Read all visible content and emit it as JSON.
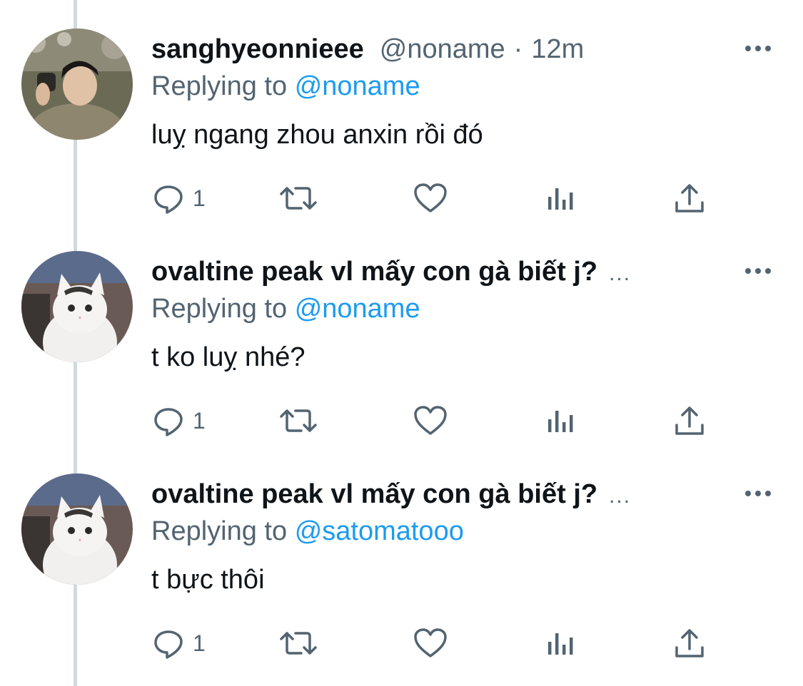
{
  "tweets": [
    {
      "name": "sanghyeonnieee",
      "handle": "@noname",
      "separator": "·",
      "time": "12m",
      "replying_prefix": "Replying to",
      "replying_to": "@noname",
      "text": "luỵ ngang zhou anxin rồi đó",
      "reply_count": "1",
      "avatar": "person-photo"
    },
    {
      "name": "ovaltine peak vl mấy con gà biết j?",
      "name_overflow": "...",
      "replying_prefix": "Replying to",
      "replying_to": "@noname",
      "text": "t ko luỵ nhé?",
      "reply_count": "1",
      "avatar": "cat-photo"
    },
    {
      "name": "ovaltine peak vl mấy con gà biết j?",
      "name_overflow": "...",
      "replying_prefix": "Replying to",
      "replying_to": "@satomatooo",
      "text": "t bực thôi",
      "reply_count": "1",
      "avatar": "cat-photo"
    }
  ],
  "colors": {
    "text": "#0f1419",
    "secondary": "#536471",
    "link": "#1d9bf0",
    "thread_line": "#cfd9de"
  },
  "icons": [
    "reply-icon",
    "retweet-icon",
    "like-icon",
    "analytics-icon",
    "share-icon",
    "more-icon"
  ]
}
